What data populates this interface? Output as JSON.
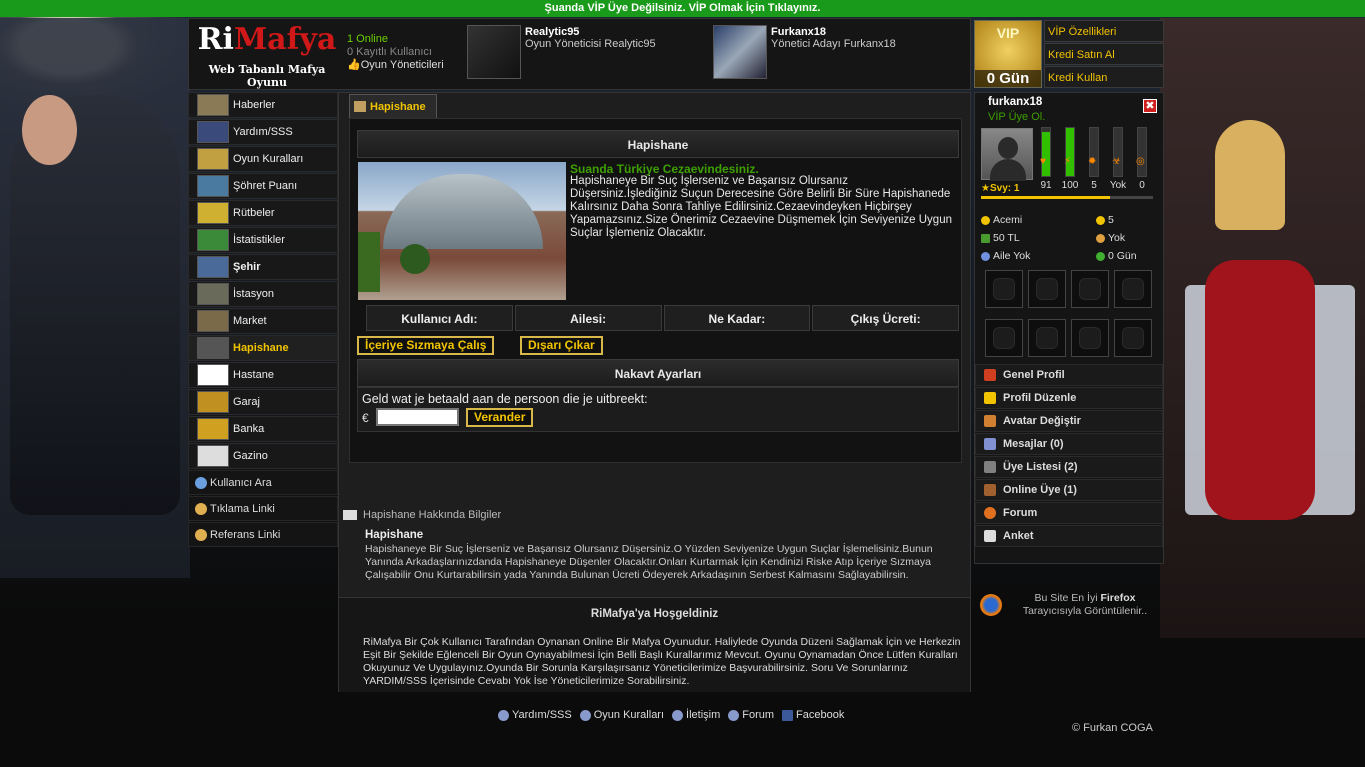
{
  "topbar": "Şuanda VİP Üye Değilsiniz. VİP Olmak İçin Tıklayınız.",
  "header": {
    "logo_ri": "Ri",
    "logo_mafya": "Mafya",
    "logo_sub": "Web Tabanlı Mafya Oyunu",
    "online_count": "1 Online",
    "registered": "0 Kayıtlı Kullanıcı",
    "admins_link": "Oyun Yöneticileri",
    "admin1": {
      "name": "Realytic95",
      "role": "Oyun Yöneticisi Realytic95"
    },
    "admin2": {
      "name": "Furkanx18",
      "role": "Yönetici Adayı Furkanx18"
    }
  },
  "vip": {
    "badge": "VIP",
    "days": "0 Gün",
    "links": [
      "VİP Özellikleri",
      "Kredi Satın Al",
      "Kredi Kullan"
    ]
  },
  "left_menu": [
    {
      "label": "Haberler",
      "icon": "newspaper-icon",
      "color": "#8a7a55"
    },
    {
      "label": "Yardım/SSS",
      "icon": "help-icon",
      "color": "#3a4a7a"
    },
    {
      "label": "Oyun Kuralları",
      "icon": "rules-icon",
      "color": "#c0a040"
    },
    {
      "label": "Şöhret Puanı",
      "icon": "fame-icon",
      "color": "#4a7aa0"
    },
    {
      "label": "Rütbeler",
      "icon": "rank-icon",
      "color": "#d0b030"
    },
    {
      "label": "İstatistikler",
      "icon": "stats-icon",
      "color": "#3a8a3a"
    },
    {
      "label": "Şehir",
      "icon": "city-icon",
      "color": "#4a6a9a"
    },
    {
      "label": "İstasyon",
      "icon": "station-icon",
      "color": "#6a6a5a"
    },
    {
      "label": "Market",
      "icon": "market-icon",
      "color": "#7a6a4a"
    },
    {
      "label": "Hapishane",
      "icon": "prison-icon",
      "color": "#555555"
    },
    {
      "label": "Hastane",
      "icon": "hospital-icon",
      "color": "#d03030"
    },
    {
      "label": "Garaj",
      "icon": "garage-icon",
      "color": "#c09020"
    },
    {
      "label": "Banka",
      "icon": "bank-icon",
      "color": "#d0a020"
    },
    {
      "label": "Gazino",
      "icon": "casino-icon",
      "color": "#ddd"
    }
  ],
  "side_links": [
    "Kullanıcı Ara",
    "Tıklama Linki",
    "Referans Linki"
  ],
  "tab": "Hapishane",
  "prison": {
    "heading": "Hapishane",
    "status": "Suanda Türkiye Cezaevindesiniz.",
    "description": "Hapishaneye Bir Suç İşlerseniz ve Başarısız Olursanız Düşersiniz.İşlediğiniz Suçun Derecesine Göre Belirli Bir Süre Hapishanede Kalırsınız Daha Sonra Tahliye Edilirsiniz.Cezaevindeyken Hiçbirşey Yapamazsınız.Size Önerimiz Cezaevine Düşmemek İçin Seviyenize Uygun Suçlar İşlemeniz Olacaktır.",
    "columns": [
      "Kullanıcı Adı:",
      "Ailesi:",
      "Ne Kadar:",
      "Çıkış Ücreti:"
    ],
    "btn_sneak": "İçeriye Sızmaya Çalış",
    "btn_out": "Dışarı Çıkar",
    "cash_heading": "Nakavt Ayarları",
    "cash_question": "Geld wat je betaald aan de persoon die je uitbreekt:",
    "currency": "€",
    "cash_value": "",
    "btn_change": "Verander"
  },
  "info": {
    "heading": "Hapishane Hakkında Bilgiler",
    "title": "Hapishane",
    "text": "Hapishaneye Bir Suç İşlerseniz ve Başarısız Olursanız Düşersiniz.O Yüzden Seviyenize Uygun Suçlar İşlemelisiniz.Bunun Yanında Arkadaşlarınızdanda Hapishaneye Düşenler Olacaktır.Onları Kurtarmak İçin Kendinizi Riske Atıp İçeriye Sızmaya Çalışabilir Onu Kurtarabilirsin yada Yanında Bulunan Ücreti Ödeyerek Arkadaşının Serbest Kalmasını Sağlayabilirsin."
  },
  "welcome": {
    "title": "RiMafya'ya Hoşgeldiniz",
    "text": "RiMafya Bir Çok Kullanıcı Tarafından Oynanan Online Bir Mafya Oyunudur. Haliylede Oyunda Düzeni Sağlamak İçin ve Herkezin Eşit Bir Şekilde Eğlenceli Bir Oyun Oynayabilmesi İçin Belli Başlı Kurallarımız Mevcut. Oyunu Oynamadan Önce Lütfen Kuralları Okuyunuz Ve Uygulayınız.Oyunda Bir Sorunla Karşılaşırsanız Yöneticilerimize Başvurabilirsiniz. Soru Ve Sorunlarınız YARDIM/SSS İçerisinde Cevabı Yok İse Yöneticilerimize Sorabilirsiniz."
  },
  "footer": [
    "Yardım/SSS",
    "Oyun Kuralları",
    "İletişim",
    "Forum",
    "Facebook"
  ],
  "copyright": "© Furkan COGA",
  "profile": {
    "username": "furkanx18",
    "vip_link": "VİP Üye Ol.",
    "close": "✖",
    "level": "Svy: 1",
    "level_fraction": 0.75,
    "bars": [
      {
        "value": "91",
        "fill": 0.91,
        "icon": "heart-icon"
      },
      {
        "value": "100",
        "fill": 1.0,
        "icon": "energy-icon"
      },
      {
        "value": "5",
        "fill": 0.0,
        "icon": "bomb-icon"
      },
      {
        "value": "Yok",
        "fill": 0.0,
        "icon": "biohazard-icon"
      },
      {
        "value": "0",
        "fill": 0.0,
        "icon": "target-icon"
      }
    ],
    "stats": [
      [
        "Acemi",
        "5"
      ],
      [
        "50 TL",
        "Yok"
      ],
      [
        "Aile Yok",
        "0 Gün"
      ]
    ],
    "inventory_row1": [
      "knife-icon",
      "helmet-icon",
      "bomb-icon",
      "grenade-icon"
    ],
    "inventory_row2": [
      "pistol-icon",
      "dog-icon",
      "car-icon",
      "vest-icon"
    ],
    "menu": [
      "Genel Profil",
      "Profil Düzenle",
      "Avatar Değiştir",
      "Mesajlar (0)",
      "Üye Listesi (2)",
      "Online Üye (1)",
      "Forum",
      "Anket"
    ],
    "menu_colors": [
      "#d04020",
      "#f2c400",
      "#d08030",
      "#8090d0",
      "#808080",
      "#a06030",
      "#e07020",
      "#dddddd"
    ]
  },
  "browser_note": {
    "line1": "Bu Site En İyi",
    "brand": "Firefox",
    "line2": "Tarayıcısıyla Görüntülenir.."
  }
}
